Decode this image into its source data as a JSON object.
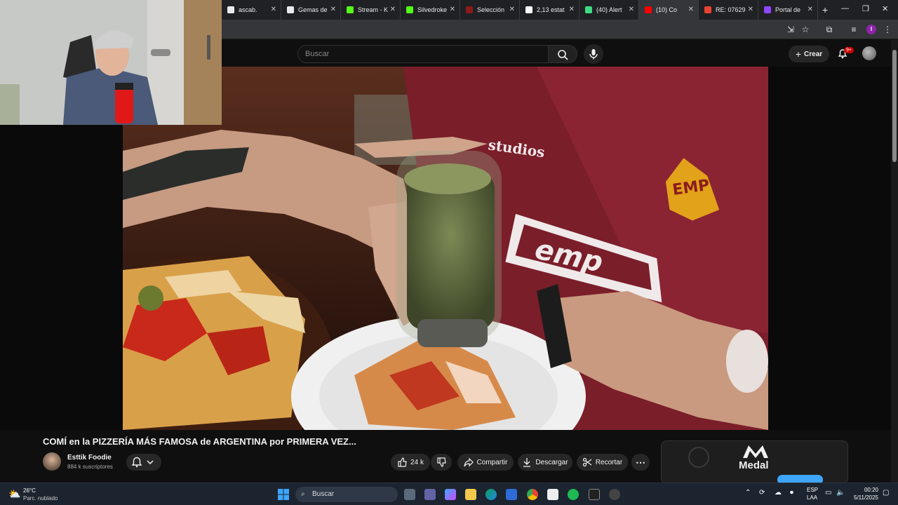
{
  "browser": {
    "tabs": [
      {
        "label": "ascab.",
        "favicon_color": "#e8eaed",
        "icon": "page-icon",
        "active": false
      },
      {
        "label": "Gemas de",
        "favicon_color": "#e8eaed",
        "icon": "globe-icon",
        "active": false
      },
      {
        "label": "Stream - K",
        "favicon_color": "#53fc18",
        "icon": "kick-icon",
        "active": false
      },
      {
        "label": "Silvedroke",
        "favicon_color": "#53fc18",
        "icon": "kick-icon",
        "active": false
      },
      {
        "label": "Selección",
        "favicon_color": "#8b1a1a",
        "icon": "page-icon",
        "active": false
      },
      {
        "label": "2,13 estat",
        "favicon_color": "#ffffff",
        "icon": "google-icon",
        "active": false
      },
      {
        "label": "(40) Alert",
        "favicon_color": "#3ddc84",
        "icon": "alert-icon",
        "active": false
      },
      {
        "label": "(10) Co",
        "favicon_color": "#ff0000",
        "icon": "youtube-icon",
        "active": true
      },
      {
        "label": "RE: 07629",
        "favicon_color": "#ea4335",
        "icon": "gmail-icon",
        "active": false
      },
      {
        "label": "Portal de",
        "favicon_color": "#9146ff",
        "icon": "twitch-icon",
        "active": false
      }
    ],
    "new_tab": "+",
    "profile_initial": "I"
  },
  "youtube": {
    "search_placeholder": "Buscar",
    "create_label": "Crear",
    "notif_badge": "9+"
  },
  "video": {
    "title": "COMÍ en la PIZZERÍA MÁS FAMOSA de ARGENTINA por PRIMERA VEZ...",
    "overlay_text_1": "studios",
    "overlay_text_2": "EMP",
    "overlay_text_3": "emp"
  },
  "channel": {
    "name": "Esttik Foodie",
    "subscribers": "884 k suscriptores"
  },
  "actions": {
    "likes": "24 k",
    "share": "Compartir",
    "download": "Descargar",
    "clip": "Recortar"
  },
  "sidebar_ad": {
    "brand": "Medal"
  },
  "taskbar": {
    "weather_temp": "26°C",
    "weather_desc": "Parc. nublado",
    "search_label": "Buscar",
    "lang_1": "ESP",
    "lang_2": "LAA",
    "time": "00:20",
    "date": "5/11/2025"
  },
  "colors": {
    "youtube_red": "#ff0000",
    "page_bg": "#0f0f0f",
    "pill_bg": "#272727",
    "shirt": "#7a1e2a"
  }
}
